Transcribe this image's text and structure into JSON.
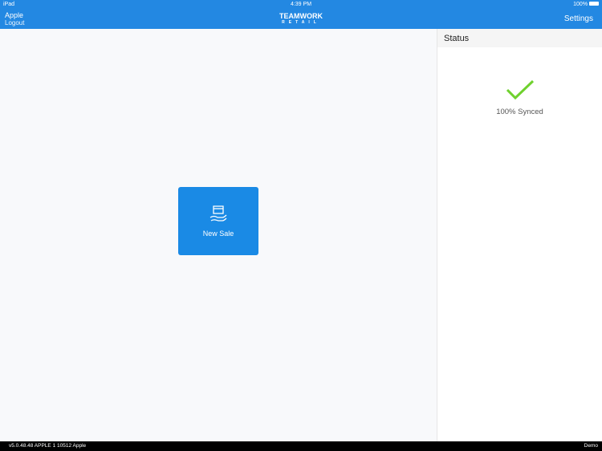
{
  "status_bar": {
    "device": "iPad",
    "time": "4:39 PM",
    "battery": "100%"
  },
  "header": {
    "user": "Apple",
    "logout": "Logout",
    "logo": "TEAMWORK",
    "logo_sub": "RETAIL",
    "settings": "Settings"
  },
  "main": {
    "new_sale": "New Sale"
  },
  "status": {
    "title": "Status",
    "sync": "100% Synced"
  },
  "footer": {
    "version": "v5.0.48.48 APPLE 1 10512 Apple",
    "mode": "Demo"
  },
  "colors": {
    "header": "#2388e2",
    "tile": "#1a8ae5",
    "check": "#6fd12e"
  }
}
